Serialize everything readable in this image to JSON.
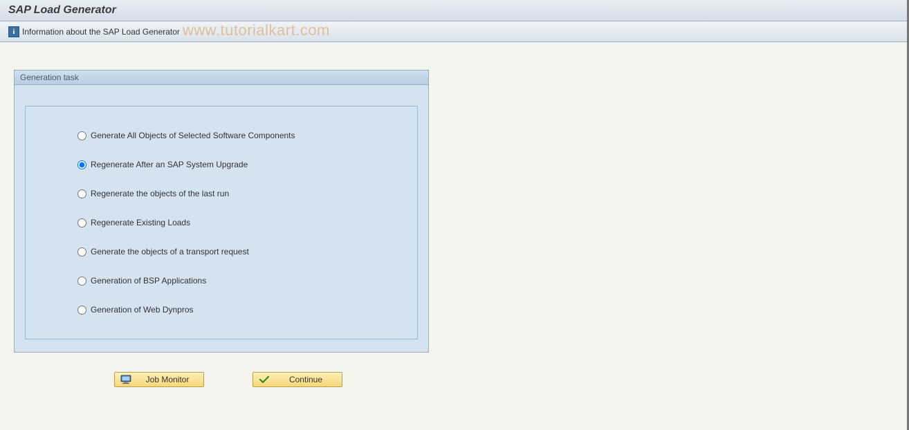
{
  "header": {
    "title": "SAP Load Generator"
  },
  "toolbar": {
    "info_text": "Information about the SAP Load Generator",
    "watermark": "www.tutorialkart.com"
  },
  "groupbox": {
    "title": "Generation task",
    "options": [
      {
        "label": "Generate All Objects of Selected Software Components",
        "selected": false
      },
      {
        "label": "Regenerate After an SAP System Upgrade",
        "selected": true
      },
      {
        "label": "Regenerate the objects of the last run",
        "selected": false
      },
      {
        "label": "Regenerate Existing Loads",
        "selected": false
      },
      {
        "label": "Generate the objects of a transport request",
        "selected": false
      },
      {
        "label": "Generation of BSP Applications",
        "selected": false
      },
      {
        "label": "Generation of Web Dynpros",
        "selected": false
      }
    ]
  },
  "buttons": {
    "job_monitor": "Job Monitor",
    "continue": "Continue"
  }
}
